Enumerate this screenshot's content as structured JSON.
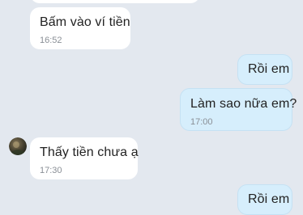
{
  "messages": [
    {
      "direction": "incoming",
      "text": "",
      "time": ""
    },
    {
      "direction": "incoming",
      "text": "Bấm vào ví tiền",
      "time": "16:52"
    },
    {
      "direction": "outgoing",
      "text": "Rồi em",
      "time": ""
    },
    {
      "direction": "outgoing",
      "text": "Làm sao nữa em?",
      "time": "17:00"
    },
    {
      "direction": "incoming",
      "text": "Thấy tiền chưa ạ",
      "time": "17:30",
      "avatar_icon": "contact-avatar-icon"
    },
    {
      "direction": "outgoing",
      "text": "Rồi em",
      "time": ""
    }
  ],
  "colors": {
    "background": "#e3e8ef",
    "incoming_bubble": "#ffffff",
    "outgoing_bubble": "#d6eefc",
    "text": "#222222",
    "timestamp": "#8a8f96"
  }
}
